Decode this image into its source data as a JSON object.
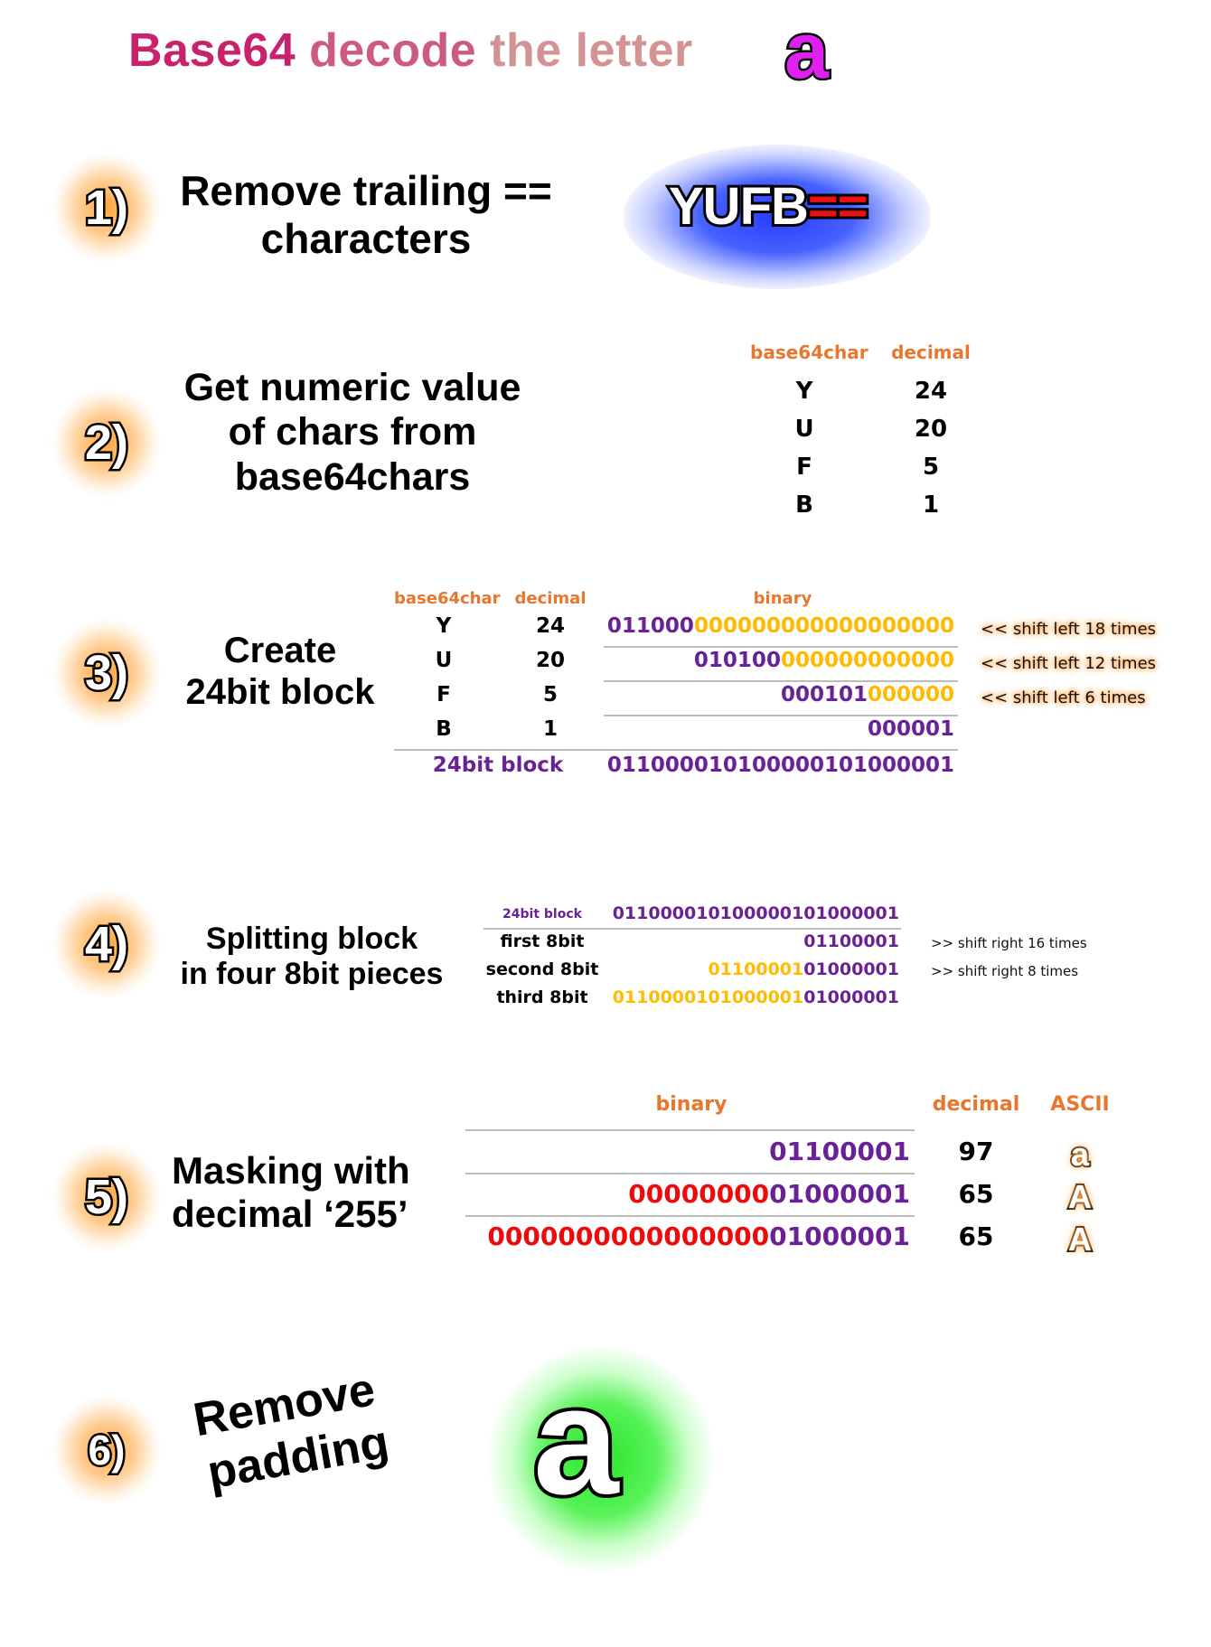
{
  "title": {
    "part1": "Base64",
    "part2": "decode",
    "part3": "the letter",
    "letter": "a"
  },
  "steps": [
    {
      "number": "1)",
      "heading_line1": "Remove trailing ==",
      "heading_line2": "characters",
      "encoded_main": "YUFB",
      "encoded_padding": "=="
    },
    {
      "number": "2)",
      "heading_line1": "Get numeric value",
      "heading_line2": "of chars from",
      "heading_line3": "base64chars",
      "table": {
        "headers": [
          "base64char",
          "decimal"
        ],
        "rows": [
          {
            "char": "Y",
            "decimal": "24"
          },
          {
            "char": "U",
            "decimal": "20"
          },
          {
            "char": "F",
            "decimal": "5"
          },
          {
            "char": "B",
            "decimal": "1"
          }
        ]
      }
    },
    {
      "number": "3)",
      "heading_line1": "Create",
      "heading_line2": "24bit block",
      "table": {
        "headers": [
          "base64char",
          "decimal",
          "binary"
        ],
        "rows": [
          {
            "char": "Y",
            "decimal": "24",
            "bits": "011000",
            "shifted_zeros": "000000000000000000",
            "note": "<< shift left 18 times"
          },
          {
            "char": "U",
            "decimal": "20",
            "bits": "010100",
            "shifted_zeros": "000000000000",
            "note": "<< shift left 12 times"
          },
          {
            "char": "F",
            "decimal": "5",
            "bits": "000101",
            "shifted_zeros": "000000",
            "note": "<< shift left 6 times"
          },
          {
            "char": "B",
            "decimal": "1",
            "bits": "000001",
            "shifted_zeros": "",
            "note": ""
          }
        ],
        "total_label": "24bit block",
        "total_value": "011000010100000101000001"
      }
    },
    {
      "number": "4)",
      "heading_line1": "Splitting block",
      "heading_line2": "in four 8bit pieces",
      "table": {
        "block_label": "24bit block",
        "block_value": "011000010100000101000001",
        "rows": [
          {
            "label": "first 8bit",
            "dropped": "",
            "kept": "01100001",
            "note": ">> shift right 16 times"
          },
          {
            "label": "second 8bit",
            "dropped": "01100001",
            "kept": "01000001",
            "note": ">> shift right 8 times"
          },
          {
            "label": "third 8bit",
            "dropped": "0110000101000001",
            "kept": "01000001",
            "note": ""
          }
        ]
      }
    },
    {
      "number": "5)",
      "heading_line1": "Masking with",
      "heading_line2": "decimal ‘255’",
      "table": {
        "headers": [
          "binary",
          "decimal",
          "ASCII"
        ],
        "rows": [
          {
            "masked": "",
            "kept": "01100001",
            "decimal": "97",
            "ascii": "a"
          },
          {
            "masked": "00000000",
            "kept": "01000001",
            "decimal": "65",
            "ascii": "A"
          },
          {
            "masked": "0000000000000000",
            "kept": "01000001",
            "decimal": "65",
            "ascii": "A"
          }
        ]
      }
    },
    {
      "number": "6)",
      "heading_line1": "Remove",
      "heading_line2": "padding",
      "result": "a"
    }
  ],
  "colors": {
    "title_dark": "#c8226e",
    "title_light": "#d49393",
    "header_orange": "#e8762c",
    "bits_purple": "#6a2196",
    "bits_yellow": "#ffbb00",
    "mask_red": "#ee0a0a",
    "glow_orange": "#ffa040",
    "glow_blue": "#2840ff",
    "glow_green": "#28e628"
  }
}
